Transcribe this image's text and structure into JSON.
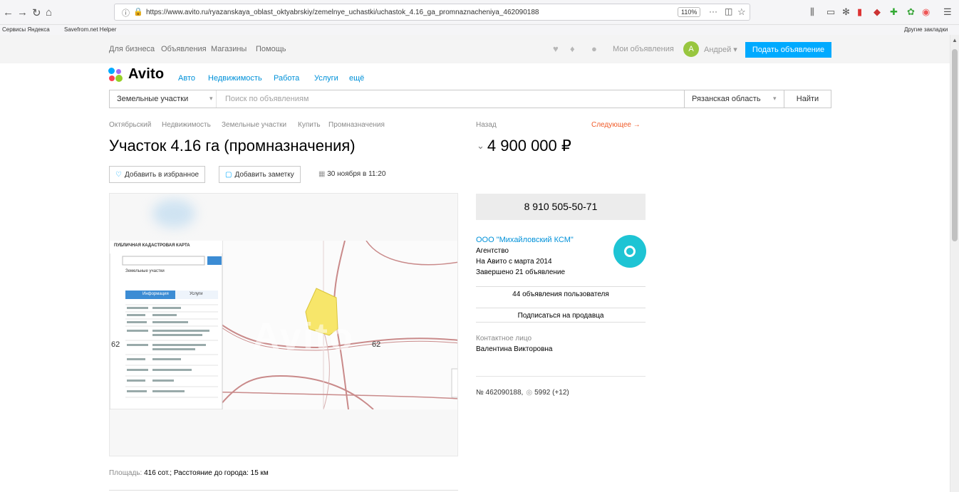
{
  "browser": {
    "url": "https://www.avito.ru/ryazanskaya_oblast_oktyabrskiy/zemelnye_uchastki/uchastok_4.16_ga_promnaznacheniya_462090188",
    "zoom": "110%",
    "bookmarks": [
      "Сервисы Яндекса",
      "Savefrom.net Helper",
      "Другие закладки"
    ]
  },
  "topbar": {
    "links": [
      "Для бизнеса",
      "Объявления",
      "Магазины",
      "Помощь"
    ],
    "my_ads": "Мои объявления",
    "avatar_letter": "А",
    "user": "Андрей",
    "post_button": "Подать объявление"
  },
  "logo": {
    "text": "Avito"
  },
  "categories": [
    "Авто",
    "Недвижимость",
    "Работа",
    "Услуги",
    "ещё"
  ],
  "search": {
    "category": "Земельные участки",
    "placeholder": "Поиск по объявлениям",
    "region": "Рязанская область",
    "button": "Найти"
  },
  "breadcrumbs": [
    "Октябрьский",
    "Недвижимость",
    "Земельные участки",
    "Купить",
    "Промназначения"
  ],
  "pager": {
    "back": "Назад",
    "next": "Следующее →"
  },
  "listing": {
    "title": "Участок 4.16 га (промназначения)",
    "price": "4 900 000 ₽",
    "favorite": "Добавить в избранное",
    "note": "Добавить заметку",
    "posted": "30 ноября в 11:20",
    "params_label": "Площадь:",
    "params_value": "416 сот.; Расстояние до города: 15 км"
  },
  "photo": {
    "map_header": "ПУБЛИЧНАЯ КАДАСТРОВАЯ КАРТА",
    "panel_title": "Земельные участки",
    "tab_info": "Информация",
    "tab_services": "Услуги",
    "map_label_left": "62",
    "map_label_right": "62",
    "watermark": "Avito"
  },
  "seller": {
    "phone": "8 910 505-50-71",
    "name": "ООО \"Михайловский КСМ\"",
    "type": "Агентство",
    "since": "На Авито с марта 2014",
    "completed": "Завершено 21 объявление",
    "ads_link": "44 объявления пользователя",
    "subscribe": "Подписаться на продавца",
    "contact_label": "Контактное лицо",
    "contact_name": "Валентина Викторовна"
  },
  "meta": {
    "id": "№ 462090188,",
    "views": "5992 (+12)"
  },
  "colors": {
    "accent": "#00aaff",
    "link": "#0091d9",
    "next": "#f05a28",
    "avatar_user": "#98c63f",
    "avatar_seller": "#1ec4d4"
  }
}
